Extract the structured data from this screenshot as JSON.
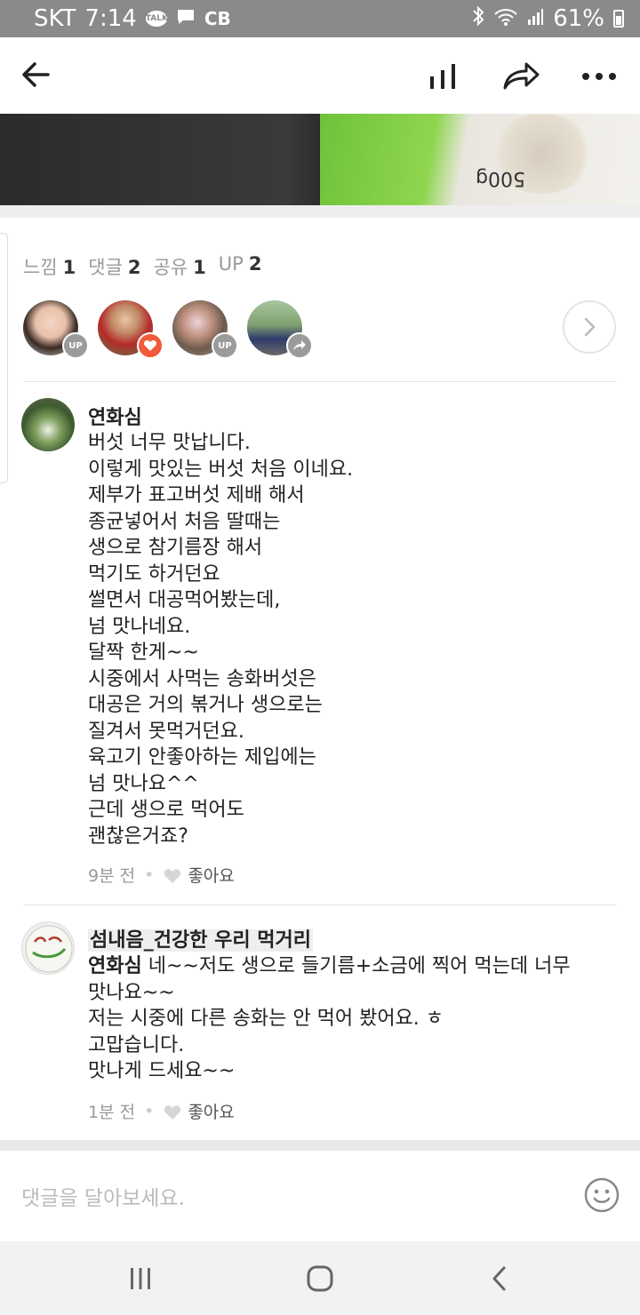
{
  "status_bar": {
    "carrier": "SKT",
    "time": "7:14",
    "talk": "TALK",
    "cb": "CB",
    "battery": "61%"
  },
  "stats": [
    {
      "label": "느낌",
      "count": "1"
    },
    {
      "label": "댓글",
      "count": "2"
    },
    {
      "label": "공유",
      "count": "1"
    },
    {
      "label": "UP",
      "count": "2"
    }
  ],
  "reactors": [
    {
      "badge": "UP",
      "type": "up"
    },
    {
      "badge": "heart",
      "type": "heart"
    },
    {
      "badge": "UP",
      "type": "up"
    },
    {
      "badge": "share",
      "type": "share"
    }
  ],
  "comments": [
    {
      "author": "연화심",
      "body": "버섯 너무 맛납니다.\n이렇게 맛있는 버섯 처음 이네요.\n제부가 표고버섯 제배 해서\n종균넣어서 처음 딸때는\n생으로 참기름장 해서\n먹기도 하거던요\n썰면서 대공먹어봤는데,\n넘 맛나네요.\n달짝 한게~~\n시중에서 사먹는 송화버섯은\n대공은 거의 볶거나 생으로는\n질겨서 못먹거던요.\n육고기 안좋아하는 제입에는\n넘 맛나요^^\n근데 생으로 먹어도\n괜찮은거죠?",
      "time": "9분 전",
      "like": "좋아요"
    },
    {
      "author": "섬내음_건강한 우리 먹거리",
      "mention": "연화심",
      "body": " 네~~저도 생으로 들기름+소금에 찍어 먹는데 너무\n맛나요~~\n저는 시중에 다른 송화는 안 먹어 봤어요. ㅎ\n고맙습니다.\n맛나게 드세요~~",
      "time": "1분 전",
      "like": "좋아요"
    }
  ],
  "input": {
    "placeholder": "댓글을 달아보세요."
  },
  "image_text": "500g"
}
